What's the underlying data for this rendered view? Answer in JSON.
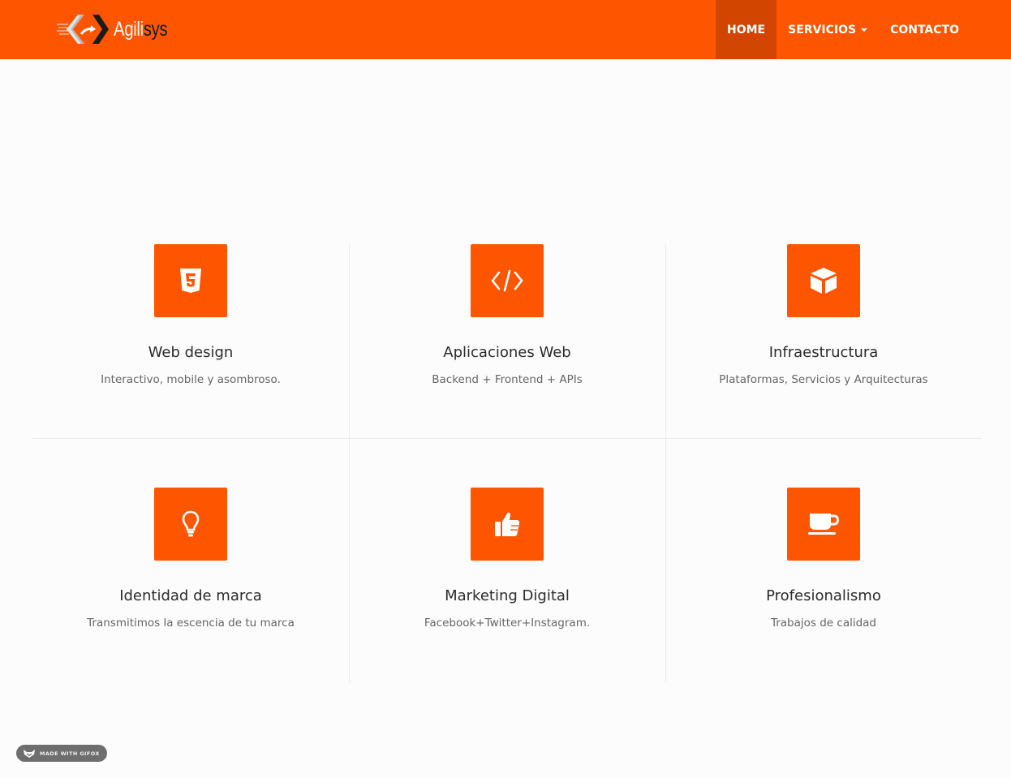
{
  "brand": {
    "name_part1": "Agili",
    "name_part2": "sys",
    "logo_icon": "double-chevron-arrows-icon"
  },
  "nav": {
    "items": [
      {
        "label": "HOME",
        "active": true
      },
      {
        "label": "SERVICIOS",
        "dropdown": true
      },
      {
        "label": "CONTACTO"
      }
    ]
  },
  "features": [
    {
      "icon": "html5-icon",
      "title": "Web design",
      "description": "Interactivo, mobile y asombroso."
    },
    {
      "icon": "code-icon",
      "title": "Aplicaciones Web",
      "description": "Backend + Frontend + APIs"
    },
    {
      "icon": "cube-icon",
      "title": "Infraestructura",
      "description": "Plataformas, Servicios y Arquitecturas"
    },
    {
      "icon": "lightbulb-icon",
      "title": "Identidad de marca",
      "description": "Transmitimos la escencia de tu marca"
    },
    {
      "icon": "thumbs-up-icon",
      "title": "Marketing Digital",
      "description": "Facebook+Twitter+Instagram."
    },
    {
      "icon": "coffee-cup-icon",
      "title": "Profesionalismo",
      "description": "Trabajos de calidad"
    }
  ],
  "badge": {
    "label": "MADE WITH GIFOX",
    "icon": "fox-icon"
  },
  "colors": {
    "primary": "#fe5500",
    "nav_active": "#d24500",
    "background": "#fcfcfc"
  }
}
